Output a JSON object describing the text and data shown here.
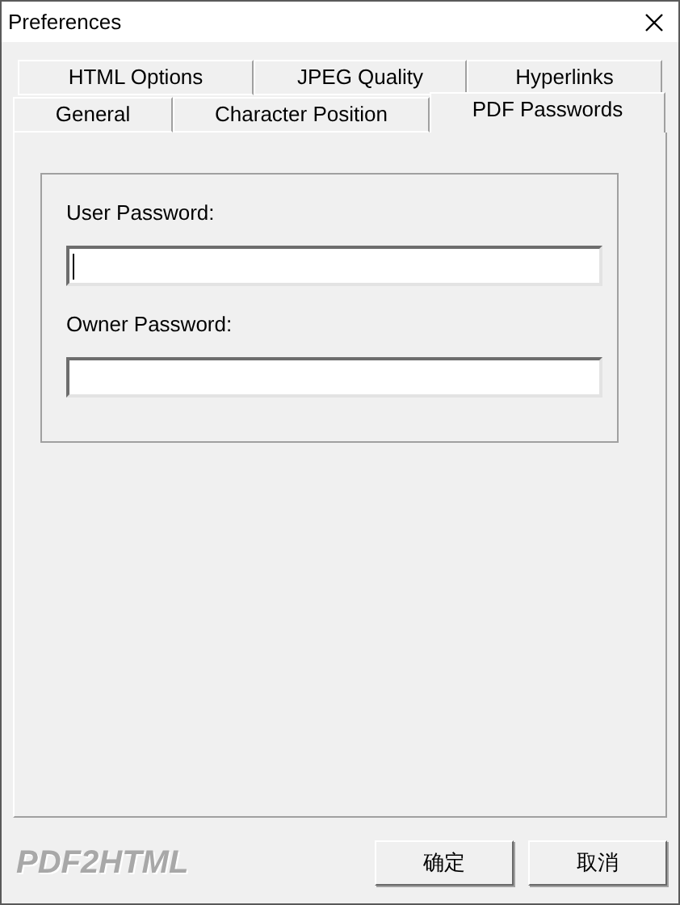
{
  "window": {
    "title": "Preferences"
  },
  "tab_rows": [
    [
      {
        "label": "HTML Options",
        "selected": false
      },
      {
        "label": "JPEG Quality",
        "selected": false
      },
      {
        "label": "Hyperlinks",
        "selected": false
      }
    ],
    [
      {
        "label": "General",
        "selected": false
      },
      {
        "label": "Character Position",
        "selected": false
      },
      {
        "label": "PDF Passwords",
        "selected": true
      }
    ]
  ],
  "fields": [
    {
      "label": "User Password:",
      "focused": true
    },
    {
      "label": "Owner Password:",
      "focused": false
    }
  ],
  "logo": "PDF2HTML",
  "buttons": [
    "确定",
    "取消"
  ]
}
